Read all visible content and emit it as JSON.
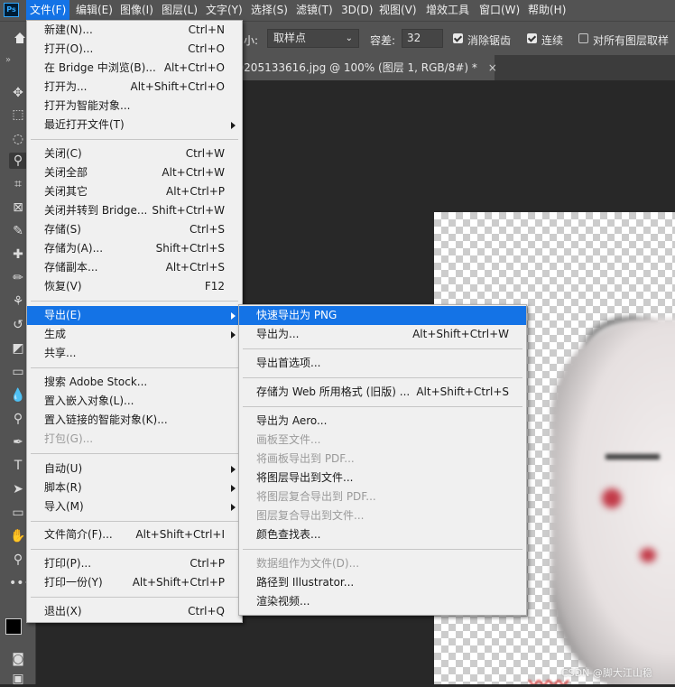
{
  "app": {
    "logo_text": "Ps"
  },
  "menubar": {
    "items": [
      "文件(F)",
      "编辑(E)",
      "图像(I)",
      "图层(L)",
      "文字(Y)",
      "选择(S)",
      "滤镜(T)",
      "3D(D)",
      "视图(V)",
      "增效工具",
      "窗口(W)",
      "帮助(H)"
    ],
    "active_index": 0
  },
  "options_bar": {
    "sample_size_label": "小:",
    "sample_size_value": "取样点",
    "tolerance_label": "容差:",
    "tolerance_value": "32",
    "anti_alias_label": "消除锯齿",
    "anti_alias_checked": true,
    "contiguous_label": "连续",
    "contiguous_checked": true,
    "all_layers_label": "对所有图层取样",
    "all_layers_checked": false
  },
  "document_tab": {
    "title": "20250205133616.jpg @ 100% (图层 1, RGB/8#) *",
    "close_glyph": "×"
  },
  "file_menu": {
    "items": [
      {
        "label": "新建(N)...",
        "shortcut": "Ctrl+N"
      },
      {
        "label": "打开(O)...",
        "shortcut": "Ctrl+O"
      },
      {
        "label": "在 Bridge 中浏览(B)...",
        "shortcut": "Alt+Ctrl+O"
      },
      {
        "label": "打开为...",
        "shortcut": "Alt+Shift+Ctrl+O"
      },
      {
        "label": "打开为智能对象...",
        "shortcut": ""
      },
      {
        "label": "最近打开文件(T)",
        "shortcut": ""
      },
      {
        "label": "关闭(C)",
        "shortcut": "Ctrl+W"
      },
      {
        "label": "关闭全部",
        "shortcut": "Alt+Ctrl+W"
      },
      {
        "label": "关闭其它",
        "shortcut": "Alt+Ctrl+P"
      },
      {
        "label": "关闭并转到 Bridge...",
        "shortcut": "Shift+Ctrl+W"
      },
      {
        "label": "存储(S)",
        "shortcut": "Ctrl+S"
      },
      {
        "label": "存储为(A)...",
        "shortcut": "Shift+Ctrl+S"
      },
      {
        "label": "存储副本...",
        "shortcut": "Alt+Ctrl+S"
      },
      {
        "label": "恢复(V)",
        "shortcut": "F12"
      },
      {
        "label": "导出(E)",
        "shortcut": ""
      },
      {
        "label": "生成",
        "shortcut": ""
      },
      {
        "label": "共享...",
        "shortcut": ""
      },
      {
        "label": "搜索 Adobe Stock...",
        "shortcut": ""
      },
      {
        "label": "置入嵌入对象(L)...",
        "shortcut": ""
      },
      {
        "label": "置入链接的智能对象(K)...",
        "shortcut": ""
      },
      {
        "label": "打包(G)...",
        "shortcut": ""
      },
      {
        "label": "自动(U)",
        "shortcut": ""
      },
      {
        "label": "脚本(R)",
        "shortcut": ""
      },
      {
        "label": "导入(M)",
        "shortcut": ""
      },
      {
        "label": "文件简介(F)...",
        "shortcut": "Alt+Shift+Ctrl+I"
      },
      {
        "label": "打印(P)...",
        "shortcut": "Ctrl+P"
      },
      {
        "label": "打印一份(Y)",
        "shortcut": "Alt+Shift+Ctrl+P"
      },
      {
        "label": "退出(X)",
        "shortcut": "Ctrl+Q"
      }
    ]
  },
  "export_menu": {
    "items": [
      {
        "label": "快速导出为 PNG",
        "shortcut": ""
      },
      {
        "label": "导出为...",
        "shortcut": "Alt+Shift+Ctrl+W"
      },
      {
        "label": "导出首选项...",
        "shortcut": ""
      },
      {
        "label": "存储为 Web 所用格式 (旧版) ...",
        "shortcut": "Alt+Shift+Ctrl+S"
      },
      {
        "label": "导出为 Aero...",
        "shortcut": ""
      },
      {
        "label": "画板至文件...",
        "shortcut": ""
      },
      {
        "label": "将画板导出到 PDF...",
        "shortcut": ""
      },
      {
        "label": "将图层导出到文件...",
        "shortcut": ""
      },
      {
        "label": "将图层复合导出到 PDF...",
        "shortcut": ""
      },
      {
        "label": "图层复合导出到文件...",
        "shortcut": ""
      },
      {
        "label": "颜色查找表...",
        "shortcut": ""
      },
      {
        "label": "数据组作为文件(D)...",
        "shortcut": ""
      },
      {
        "label": "路径到 Illustrator...",
        "shortcut": ""
      },
      {
        "label": "渲染视频...",
        "shortcut": ""
      }
    ]
  },
  "watermark": "CSDN @脚大江山稳",
  "colors": {
    "accent": "#1473e6",
    "menubar_bg": "#535353",
    "menu_bg": "#f0f0f0",
    "disabled_text": "#9a9a9a"
  }
}
